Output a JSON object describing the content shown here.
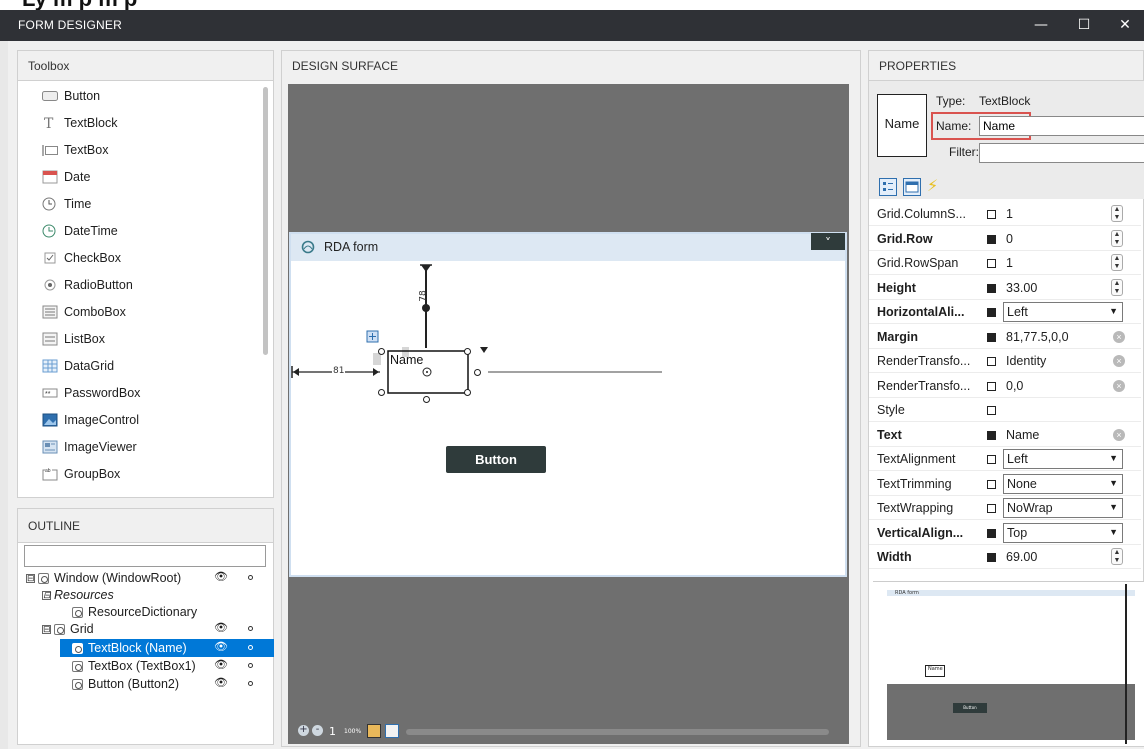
{
  "heading_fragment": "Ly   m   p   m   p",
  "window": {
    "title": "FORM DESIGNER",
    "controls": {
      "minimize": "—",
      "maximize": "☐",
      "close": "✕"
    }
  },
  "toolbox": {
    "header": "Toolbox",
    "items": [
      {
        "label": "Button",
        "icon": "button-icon"
      },
      {
        "label": "TextBlock",
        "icon": "textblock-icon"
      },
      {
        "label": "TextBox",
        "icon": "textbox-icon"
      },
      {
        "label": "Date",
        "icon": "calendar-icon"
      },
      {
        "label": "Time",
        "icon": "clock-icon"
      },
      {
        "label": "DateTime",
        "icon": "datetime-icon"
      },
      {
        "label": "CheckBox",
        "icon": "checkbox-icon"
      },
      {
        "label": "RadioButton",
        "icon": "radio-icon"
      },
      {
        "label": "ComboBox",
        "icon": "combobox-icon"
      },
      {
        "label": "ListBox",
        "icon": "listbox-icon"
      },
      {
        "label": "DataGrid",
        "icon": "datagrid-icon"
      },
      {
        "label": "PasswordBox",
        "icon": "password-icon"
      },
      {
        "label": "ImageControl",
        "icon": "image-icon"
      },
      {
        "label": "ImageViewer",
        "icon": "imageviewer-icon"
      },
      {
        "label": "GroupBox",
        "icon": "groupbox-icon"
      }
    ]
  },
  "outline": {
    "header": "OUTLINE",
    "search_value": "",
    "tree": [
      {
        "label": "Window (WindowRoot)",
        "level": 0,
        "expander": "⊟",
        "selected": false
      },
      {
        "label": "Resources",
        "level": 1,
        "expander": "⊟",
        "selected": false
      },
      {
        "label": "ResourceDictionary",
        "level": 2,
        "expander": "",
        "selected": false
      },
      {
        "label": "Grid",
        "level": 1,
        "expander": "⊟",
        "selected": false
      },
      {
        "label": "TextBlock (Name)",
        "level": 2,
        "expander": "",
        "selected": true
      },
      {
        "label": "TextBox (TextBox1)",
        "level": 2,
        "expander": "",
        "selected": false
      },
      {
        "label": "Button (Button2)",
        "level": 2,
        "expander": "",
        "selected": false
      }
    ]
  },
  "design": {
    "header": "DESIGN SURFACE",
    "form_title": "RDA form",
    "collapse_glyph": "˅",
    "textblock_text": "Name",
    "margin_left_label": "81",
    "margin_top_label": "78",
    "button_label": "Button",
    "zoom_text": "1",
    "zoom_percent": "100%"
  },
  "properties": {
    "header": "PROPERTIES",
    "preview": "Name",
    "type_label": "Type:",
    "type_value": "TextBlock",
    "name_label": "Name:",
    "name_value": "Name",
    "filter_label": "Filter:",
    "filter_value": "",
    "rows": [
      {
        "name": "Grid.ColumnS...",
        "bold": false,
        "filled": false,
        "value": "1",
        "kind": "spin"
      },
      {
        "name": "Grid.Row",
        "bold": true,
        "filled": true,
        "value": "0",
        "kind": "spin"
      },
      {
        "name": "Grid.RowSpan",
        "bold": false,
        "filled": false,
        "value": "1",
        "kind": "spin"
      },
      {
        "name": "Height",
        "bold": true,
        "filled": true,
        "value": "33.00",
        "kind": "spin"
      },
      {
        "name": "HorizontalAli...",
        "bold": true,
        "filled": true,
        "value": "Left",
        "kind": "dropdown"
      },
      {
        "name": "Margin",
        "bold": true,
        "filled": true,
        "value": "81,77.5,0,0",
        "kind": "clear"
      },
      {
        "name": "RenderTransfo...",
        "bold": false,
        "filled": false,
        "value": "Identity",
        "kind": "clear"
      },
      {
        "name": "RenderTransfo...",
        "bold": false,
        "filled": false,
        "value": "0,0",
        "kind": "clear"
      },
      {
        "name": "Style",
        "bold": false,
        "filled": false,
        "value": "",
        "kind": "text"
      },
      {
        "name": "Text",
        "bold": true,
        "filled": true,
        "value": "Name",
        "kind": "clear"
      },
      {
        "name": "TextAlignment",
        "bold": false,
        "filled": false,
        "value": "Left",
        "kind": "dropdown"
      },
      {
        "name": "TextTrimming",
        "bold": false,
        "filled": false,
        "value": "None",
        "kind": "dropdown"
      },
      {
        "name": "TextWrapping",
        "bold": false,
        "filled": false,
        "value": "NoWrap",
        "kind": "dropdown"
      },
      {
        "name": "VerticalAlign...",
        "bold": true,
        "filled": true,
        "value": "Top",
        "kind": "dropdown"
      },
      {
        "name": "Width",
        "bold": true,
        "filled": true,
        "value": "69.00",
        "kind": "spin"
      }
    ],
    "minimap": {
      "form_title": "RDA form",
      "name_text": "Name",
      "button_text": "Button"
    }
  },
  "colors": {
    "titlebar": "#2f3136",
    "selection": "#0078d7",
    "form_header": "#dde8f3",
    "canvas": "#6f6f6f",
    "design_button": "#2f3b3b"
  }
}
